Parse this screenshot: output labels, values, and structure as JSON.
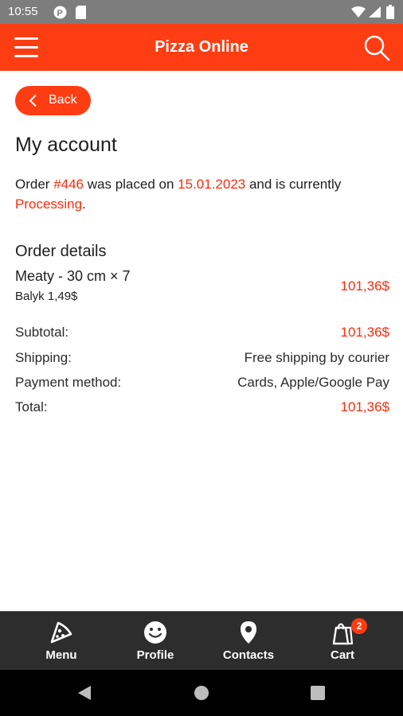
{
  "status_bar": {
    "time": "10:55"
  },
  "app_bar": {
    "title": "Pizza Online"
  },
  "back_label": "Back",
  "page_title": "My account",
  "order": {
    "prefix": "Order ",
    "number": "#446",
    "placed_text": " was placed on ",
    "date": "15.01.2023",
    "current_text": " and is currently ",
    "status": "Processing",
    "end": "."
  },
  "order_details": {
    "title": "Order details",
    "item_name": "Meaty - 30 cm × 7",
    "item_extra": "Balyk 1,49$",
    "item_price": "101,36$"
  },
  "summary": [
    {
      "label": "Subtotal:",
      "value": "101,36$",
      "highlight": true
    },
    {
      "label": "Shipping:",
      "value": "Free shipping by courier",
      "highlight": false
    },
    {
      "label": "Payment method:",
      "value": "Cards, Apple/Google Pay",
      "highlight": false
    },
    {
      "label": "Total:",
      "value": "101,36$",
      "highlight": true
    }
  ],
  "bottom_nav": {
    "items": [
      {
        "label": "Menu",
        "icon": "pizza-slice-icon"
      },
      {
        "label": "Profile",
        "icon": "smiley-icon"
      },
      {
        "label": "Contacts",
        "icon": "map-pin-icon"
      },
      {
        "label": "Cart",
        "icon": "shopping-bag-icon"
      }
    ],
    "cart_badge": "2"
  },
  "colors": {
    "accent": "#ff3d12",
    "highlight_text": "#ff2a0a",
    "nav_bg": "#2d2d2d"
  }
}
